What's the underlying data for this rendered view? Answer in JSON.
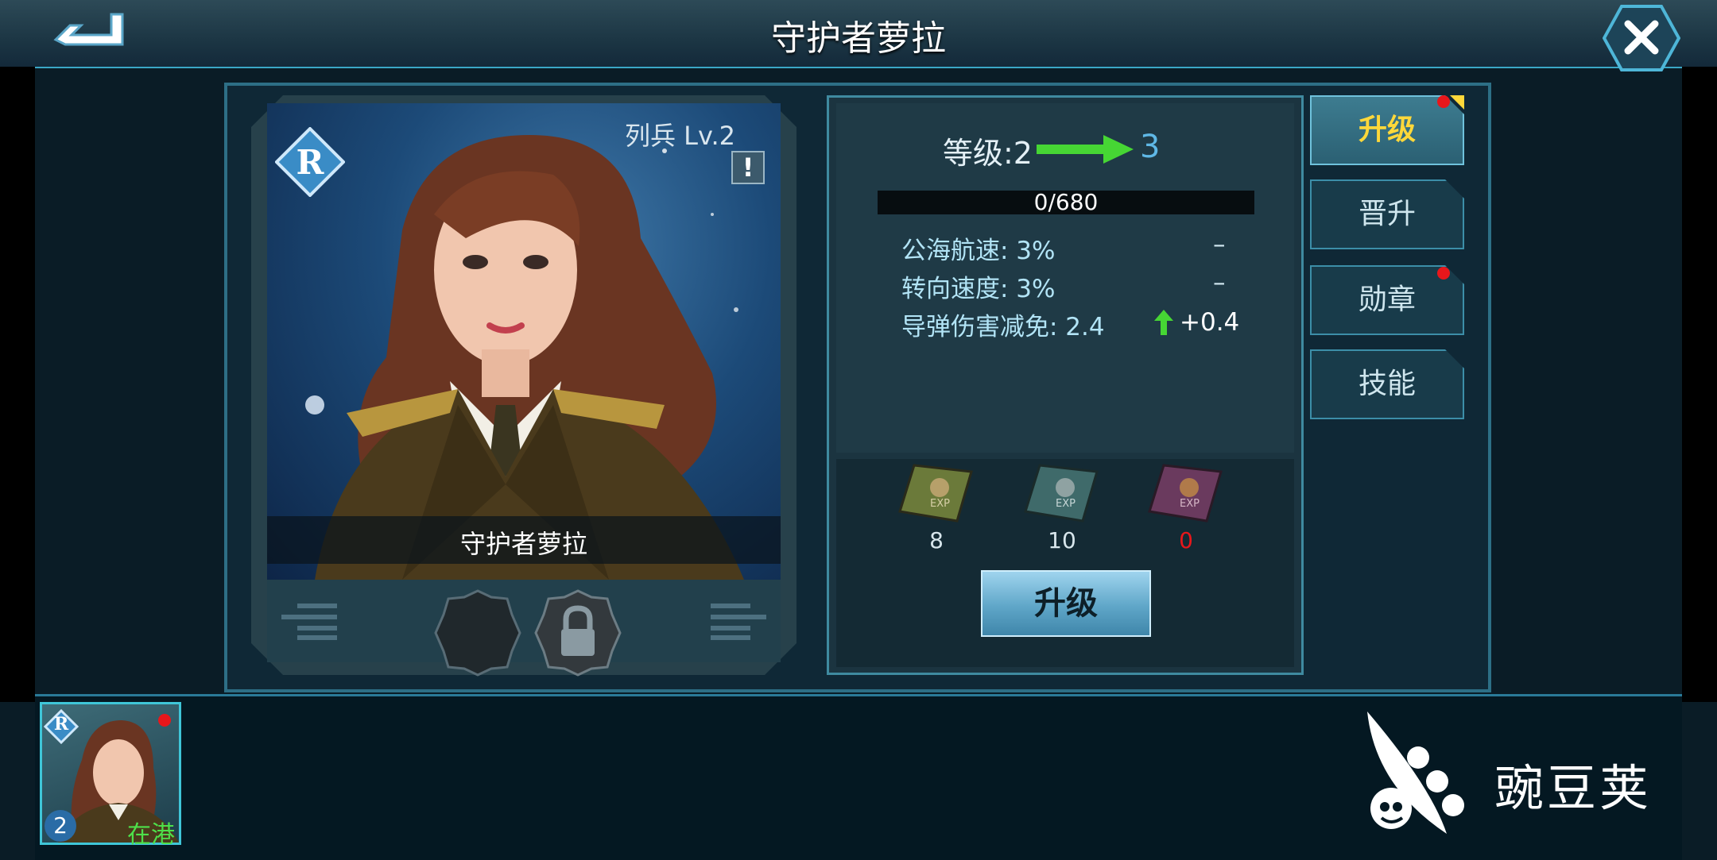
{
  "header": {
    "title": "守护者萝拉"
  },
  "card": {
    "rarity": "R",
    "rank": "列兵 Lv.2",
    "name": "守护者萝拉",
    "info_icon": "!"
  },
  "stats": {
    "level_label": "等级:2",
    "level_next": "3",
    "exp": "0/680",
    "rows": [
      {
        "label": "公海航速: 3%",
        "change": "–"
      },
      {
        "label": "转向速度: 3%",
        "change": "–"
      },
      {
        "label": "导弹伤害减免: 2.4",
        "change": "+0.4"
      }
    ]
  },
  "items": [
    {
      "name": "exp-book-green",
      "count": "8",
      "color": "#6b7a3a"
    },
    {
      "name": "exp-book-blue",
      "count": "10",
      "color": "#3f6a6a"
    },
    {
      "name": "exp-book-purple",
      "count": "0",
      "color": "#6a3a5e"
    }
  ],
  "upgrade_button": "升级",
  "tabs": [
    {
      "label": "升级",
      "active": true,
      "dot": true
    },
    {
      "label": "晋升",
      "active": false,
      "dot": false
    },
    {
      "label": "勋章",
      "active": false,
      "dot": true
    },
    {
      "label": "技能",
      "active": false,
      "dot": false
    }
  ],
  "roster": {
    "rarity": "R",
    "level": "2",
    "status": "在港"
  },
  "watermark": "豌豆荚",
  "colors": {
    "accent": "#3aa7c6",
    "active_tab_text": "#ffd83a",
    "green_arrow": "#46d634",
    "count_zero": "#e8171b"
  }
}
